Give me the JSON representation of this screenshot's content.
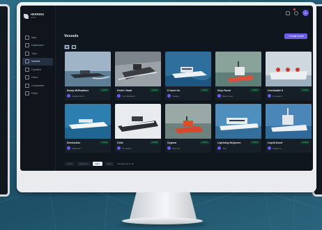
{
  "app": {
    "brand": "HERRING",
    "brand_sub": "marine",
    "accent_color": "#6c5ce7",
    "status_color": "#45c98a"
  },
  "sidebar": {
    "items": [
      {
        "label": "Map",
        "icon": "map-icon",
        "active": false
      },
      {
        "label": "Dashboard",
        "icon": "dashboard-icon",
        "active": false
      },
      {
        "label": "Trips",
        "icon": "route-icon",
        "active": false
      },
      {
        "label": "Vessels",
        "icon": "boat-icon",
        "active": true
      },
      {
        "label": "Captains",
        "icon": "captain-icon",
        "active": false
      },
      {
        "label": "Users",
        "icon": "users-icon",
        "active": false
      },
      {
        "label": "Companies",
        "icon": "building-icon",
        "active": false
      },
      {
        "label": "Roles",
        "icon": "shield-icon",
        "active": false
      }
    ]
  },
  "header": {
    "notification_icon": "bell-icon",
    "theme_icon": "moon-icon",
    "avatar_initial": "A"
  },
  "page": {
    "title": "Vessels",
    "create_label": "+ Create vessel"
  },
  "view_toggle": [
    "grid-icon",
    "list-icon"
  ],
  "vessels": [
    {
      "name": "Booty McBoatface",
      "status": "• Active",
      "owner": "Captain Morris"
    },
    {
      "name": "Feelin' Nauti",
      "status": "• Active",
      "owner": "John Matthews"
    },
    {
      "name": "Il Yacht Un",
      "status": "• Active",
      "owner": "Seadog"
    },
    {
      "name": "Ship Faced",
      "status": "• Active",
      "owner": "Brian Fraser"
    },
    {
      "name": "Unsinkable II",
      "status": "• Active",
      "owner": "No captain"
    },
    {
      "name": "Seeduction",
      "status": "• Active",
      "owner": "Seasoned"
    },
    {
      "name": "Orbit",
      "status": "• Active",
      "owner": "No captain"
    },
    {
      "name": "Gypsea",
      "status": "• Active",
      "owner": "Reel Life"
    },
    {
      "name": "Lightning McQueen",
      "status": "• Active",
      "owner": "Vitro"
    },
    {
      "name": "Liquid Asset",
      "status": "• Active",
      "owner": "Captain S."
    }
  ],
  "pagination": {
    "first": "First",
    "prev": "Previous",
    "next": "Next",
    "last": "Last",
    "info": "Showing 10 of 10"
  }
}
